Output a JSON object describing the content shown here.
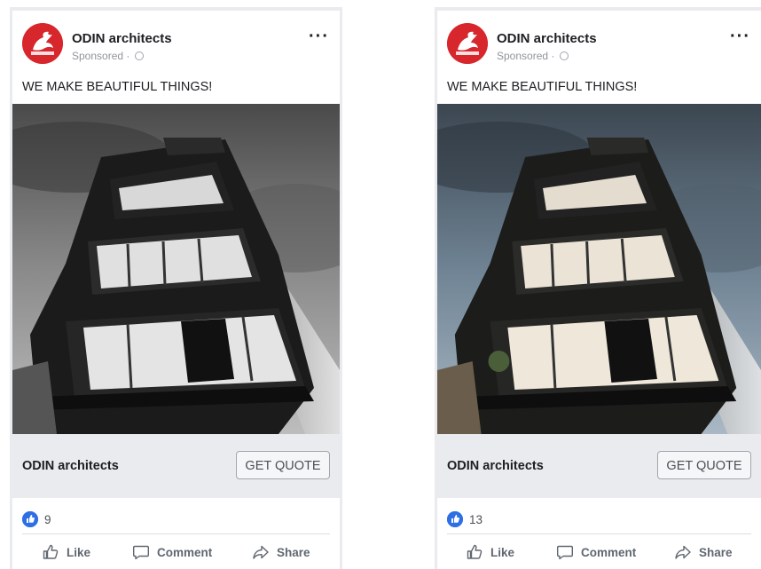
{
  "posts": [
    {
      "page_name": "ODIN architects",
      "sponsored_label": "Sponsored",
      "post_text": "WE MAKE BEAUTIFUL THINGS!",
      "cta_name": "ODIN architects",
      "cta_button": "GET QUOTE",
      "like_count": "9",
      "actions": {
        "like": "Like",
        "comment": "Comment",
        "share": "Share"
      },
      "photo_tone": "black-and-white"
    },
    {
      "page_name": "ODIN architects",
      "sponsored_label": "Sponsored",
      "post_text": "WE MAKE BEAUTIFUL THINGS!",
      "cta_name": "ODIN architects",
      "cta_button": "GET QUOTE",
      "like_count": "13",
      "actions": {
        "like": "Like",
        "comment": "Comment",
        "share": "Share"
      },
      "photo_tone": "color"
    }
  ],
  "colors": {
    "brand_red": "#d7262c",
    "like_blue": "#2e6fe6",
    "text_primary": "#1c1e21",
    "text_secondary": "#606770"
  },
  "icons": [
    "odin-logo-icon",
    "globe-icon",
    "more-options-icon",
    "like-reaction-icon",
    "thumbs-up-icon",
    "comment-icon",
    "share-icon"
  ]
}
